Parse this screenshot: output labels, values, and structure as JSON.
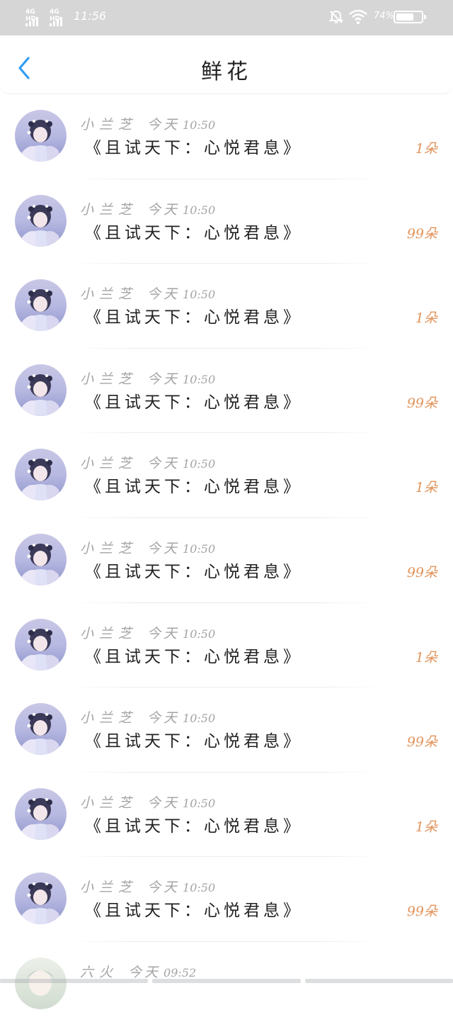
{
  "status_bar": {
    "network_1": "4G HD",
    "network_2": "4G HD",
    "time": "11:56",
    "battery_percent": "74%",
    "battery_level": 0.74
  },
  "nav": {
    "title": "鲜花"
  },
  "colors": {
    "accent_blue": "#2f9ef3",
    "count_orange": "#e2935a",
    "meta_gray": "#a4a4a4"
  },
  "records": [
    {
      "user": "小兰芝",
      "date": "今天",
      "time": "10:50",
      "book": "《且试天下：心悦君息》",
      "count": "1朵"
    },
    {
      "user": "小兰芝",
      "date": "今天",
      "time": "10:50",
      "book": "《且试天下：心悦君息》",
      "count": "99朵"
    },
    {
      "user": "小兰芝",
      "date": "今天",
      "time": "10:50",
      "book": "《且试天下：心悦君息》",
      "count": "1朵"
    },
    {
      "user": "小兰芝",
      "date": "今天",
      "time": "10:50",
      "book": "《且试天下：心悦君息》",
      "count": "99朵"
    },
    {
      "user": "小兰芝",
      "date": "今天",
      "time": "10:50",
      "book": "《且试天下：心悦君息》",
      "count": "1朵"
    },
    {
      "user": "小兰芝",
      "date": "今天",
      "time": "10:50",
      "book": "《且试天下：心悦君息》",
      "count": "99朵"
    },
    {
      "user": "小兰芝",
      "date": "今天",
      "time": "10:50",
      "book": "《且试天下：心悦君息》",
      "count": "1朵"
    },
    {
      "user": "小兰芝",
      "date": "今天",
      "time": "10:50",
      "book": "《且试天下：心悦君息》",
      "count": "99朵"
    },
    {
      "user": "小兰芝",
      "date": "今天",
      "time": "10:50",
      "book": "《且试天下：心悦君息》",
      "count": "1朵"
    },
    {
      "user": "小兰芝",
      "date": "今天",
      "time": "10:50",
      "book": "《且试天下：心悦君息》",
      "count": "99朵"
    },
    {
      "user": "六火",
      "date": "今天",
      "time": "09:52",
      "book": "",
      "count": ""
    }
  ]
}
